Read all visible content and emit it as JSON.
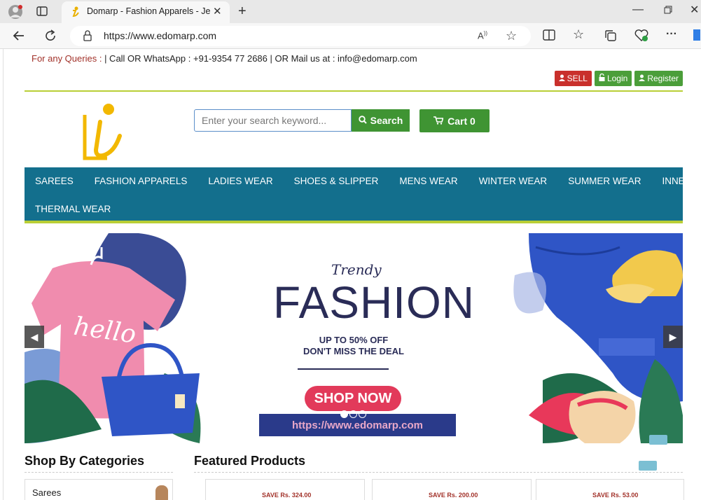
{
  "browser": {
    "tab_title": "Domarp - Fashion Apparels - Jen",
    "url": "https://www.edomarp.com"
  },
  "header": {
    "query_label": "For any Queries :",
    "query_contact": "| Call OR WhatsApp : +91-9354 77 2686 | OR Mail us at : info@edomarp.com",
    "sell_label": "SELL",
    "login_label": "Login",
    "register_label": "Register"
  },
  "search": {
    "placeholder": "Enter your search keyword...",
    "button_label": "Search"
  },
  "cart": {
    "label": "Cart 0"
  },
  "nav": {
    "items": [
      "SAREES",
      "FASHION APPARELS",
      "LADIES WEAR",
      "SHOES & SLIPPER",
      "MENS WEAR",
      "WINTER WEAR",
      "SUMMER WEAR",
      "INNER WEAR",
      "THERMAL WEAR"
    ]
  },
  "banner": {
    "trendy": "Trendy",
    "title": "FASHION",
    "sub1": "UP TO 50% OFF",
    "sub2": "DON'T MISS THE DEAL",
    "cta": "SHOP NOW",
    "url": "https://www.edomarp.com",
    "hello_text": "hello",
    "active_slide": 1,
    "slide_count": 3
  },
  "sections": {
    "categories_title": "Shop By Categories",
    "featured_title": "Featured Products"
  },
  "categories": [
    "Sarees"
  ],
  "featured": [
    {
      "save": "SAVE Rs. 324.00"
    },
    {
      "save": "SAVE Rs. 200.00"
    },
    {
      "save": "SAVE Rs. 53.00"
    }
  ],
  "colors": {
    "nav_bg": "#136f8d",
    "accent_green": "#3f9433",
    "rule_lime": "#b9ce36",
    "sell_red": "#c9302c",
    "query_red": "#a2322a",
    "banner_navy": "#2a2c57"
  }
}
